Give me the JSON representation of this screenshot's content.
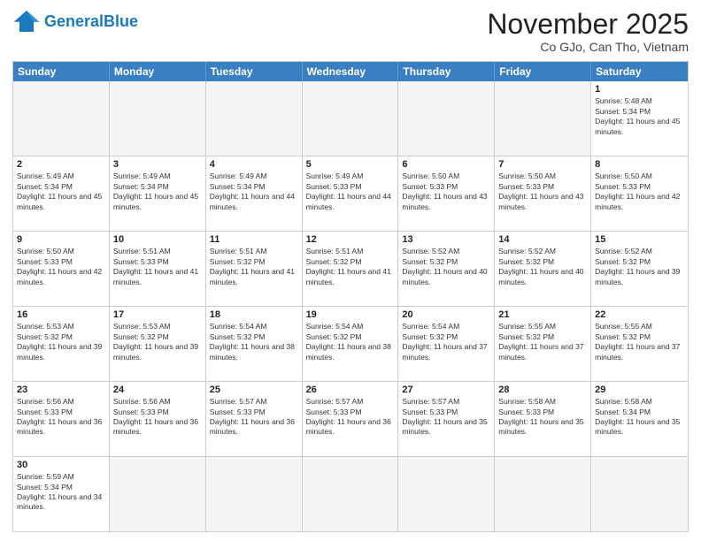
{
  "header": {
    "logo_general": "General",
    "logo_blue": "Blue",
    "month_title": "November 2025",
    "location": "Co GJo, Can Tho, Vietnam"
  },
  "days_of_week": [
    "Sunday",
    "Monday",
    "Tuesday",
    "Wednesday",
    "Thursday",
    "Friday",
    "Saturday"
  ],
  "rows": [
    [
      {
        "day": "",
        "empty": true
      },
      {
        "day": "",
        "empty": true
      },
      {
        "day": "",
        "empty": true
      },
      {
        "day": "",
        "empty": true
      },
      {
        "day": "",
        "empty": true
      },
      {
        "day": "",
        "empty": true
      },
      {
        "day": "1",
        "sunrise": "Sunrise: 5:48 AM",
        "sunset": "Sunset: 5:34 PM",
        "daylight": "Daylight: 11 hours and 45 minutes."
      }
    ],
    [
      {
        "day": "2",
        "sunrise": "Sunrise: 5:49 AM",
        "sunset": "Sunset: 5:34 PM",
        "daylight": "Daylight: 11 hours and 45 minutes."
      },
      {
        "day": "3",
        "sunrise": "Sunrise: 5:49 AM",
        "sunset": "Sunset: 5:34 PM",
        "daylight": "Daylight: 11 hours and 45 minutes."
      },
      {
        "day": "4",
        "sunrise": "Sunrise: 5:49 AM",
        "sunset": "Sunset: 5:34 PM",
        "daylight": "Daylight: 11 hours and 44 minutes."
      },
      {
        "day": "5",
        "sunrise": "Sunrise: 5:49 AM",
        "sunset": "Sunset: 5:33 PM",
        "daylight": "Daylight: 11 hours and 44 minutes."
      },
      {
        "day": "6",
        "sunrise": "Sunrise: 5:50 AM",
        "sunset": "Sunset: 5:33 PM",
        "daylight": "Daylight: 11 hours and 43 minutes."
      },
      {
        "day": "7",
        "sunrise": "Sunrise: 5:50 AM",
        "sunset": "Sunset: 5:33 PM",
        "daylight": "Daylight: 11 hours and 43 minutes."
      },
      {
        "day": "8",
        "sunrise": "Sunrise: 5:50 AM",
        "sunset": "Sunset: 5:33 PM",
        "daylight": "Daylight: 11 hours and 42 minutes."
      }
    ],
    [
      {
        "day": "9",
        "sunrise": "Sunrise: 5:50 AM",
        "sunset": "Sunset: 5:33 PM",
        "daylight": "Daylight: 11 hours and 42 minutes."
      },
      {
        "day": "10",
        "sunrise": "Sunrise: 5:51 AM",
        "sunset": "Sunset: 5:33 PM",
        "daylight": "Daylight: 11 hours and 41 minutes."
      },
      {
        "day": "11",
        "sunrise": "Sunrise: 5:51 AM",
        "sunset": "Sunset: 5:32 PM",
        "daylight": "Daylight: 11 hours and 41 minutes."
      },
      {
        "day": "12",
        "sunrise": "Sunrise: 5:51 AM",
        "sunset": "Sunset: 5:32 PM",
        "daylight": "Daylight: 11 hours and 41 minutes."
      },
      {
        "day": "13",
        "sunrise": "Sunrise: 5:52 AM",
        "sunset": "Sunset: 5:32 PM",
        "daylight": "Daylight: 11 hours and 40 minutes."
      },
      {
        "day": "14",
        "sunrise": "Sunrise: 5:52 AM",
        "sunset": "Sunset: 5:32 PM",
        "daylight": "Daylight: 11 hours and 40 minutes."
      },
      {
        "day": "15",
        "sunrise": "Sunrise: 5:52 AM",
        "sunset": "Sunset: 5:32 PM",
        "daylight": "Daylight: 11 hours and 39 minutes."
      }
    ],
    [
      {
        "day": "16",
        "sunrise": "Sunrise: 5:53 AM",
        "sunset": "Sunset: 5:32 PM",
        "daylight": "Daylight: 11 hours and 39 minutes."
      },
      {
        "day": "17",
        "sunrise": "Sunrise: 5:53 AM",
        "sunset": "Sunset: 5:32 PM",
        "daylight": "Daylight: 11 hours and 39 minutes."
      },
      {
        "day": "18",
        "sunrise": "Sunrise: 5:54 AM",
        "sunset": "Sunset: 5:32 PM",
        "daylight": "Daylight: 11 hours and 38 minutes."
      },
      {
        "day": "19",
        "sunrise": "Sunrise: 5:54 AM",
        "sunset": "Sunset: 5:32 PM",
        "daylight": "Daylight: 11 hours and 38 minutes."
      },
      {
        "day": "20",
        "sunrise": "Sunrise: 5:54 AM",
        "sunset": "Sunset: 5:32 PM",
        "daylight": "Daylight: 11 hours and 37 minutes."
      },
      {
        "day": "21",
        "sunrise": "Sunrise: 5:55 AM",
        "sunset": "Sunset: 5:32 PM",
        "daylight": "Daylight: 11 hours and 37 minutes."
      },
      {
        "day": "22",
        "sunrise": "Sunrise: 5:55 AM",
        "sunset": "Sunset: 5:32 PM",
        "daylight": "Daylight: 11 hours and 37 minutes."
      }
    ],
    [
      {
        "day": "23",
        "sunrise": "Sunrise: 5:56 AM",
        "sunset": "Sunset: 5:33 PM",
        "daylight": "Daylight: 11 hours and 36 minutes."
      },
      {
        "day": "24",
        "sunrise": "Sunrise: 5:56 AM",
        "sunset": "Sunset: 5:33 PM",
        "daylight": "Daylight: 11 hours and 36 minutes."
      },
      {
        "day": "25",
        "sunrise": "Sunrise: 5:57 AM",
        "sunset": "Sunset: 5:33 PM",
        "daylight": "Daylight: 11 hours and 36 minutes."
      },
      {
        "day": "26",
        "sunrise": "Sunrise: 5:57 AM",
        "sunset": "Sunset: 5:33 PM",
        "daylight": "Daylight: 11 hours and 36 minutes."
      },
      {
        "day": "27",
        "sunrise": "Sunrise: 5:57 AM",
        "sunset": "Sunset: 5:33 PM",
        "daylight": "Daylight: 11 hours and 35 minutes."
      },
      {
        "day": "28",
        "sunrise": "Sunrise: 5:58 AM",
        "sunset": "Sunset: 5:33 PM",
        "daylight": "Daylight: 11 hours and 35 minutes."
      },
      {
        "day": "29",
        "sunrise": "Sunrise: 5:58 AM",
        "sunset": "Sunset: 5:34 PM",
        "daylight": "Daylight: 11 hours and 35 minutes."
      }
    ],
    [
      {
        "day": "30",
        "sunrise": "Sunrise: 5:59 AM",
        "sunset": "Sunset: 5:34 PM",
        "daylight": "Daylight: 11 hours and 34 minutes."
      },
      {
        "day": "",
        "empty": true
      },
      {
        "day": "",
        "empty": true
      },
      {
        "day": "",
        "empty": true
      },
      {
        "day": "",
        "empty": true
      },
      {
        "day": "",
        "empty": true
      },
      {
        "day": "",
        "empty": true
      }
    ]
  ]
}
